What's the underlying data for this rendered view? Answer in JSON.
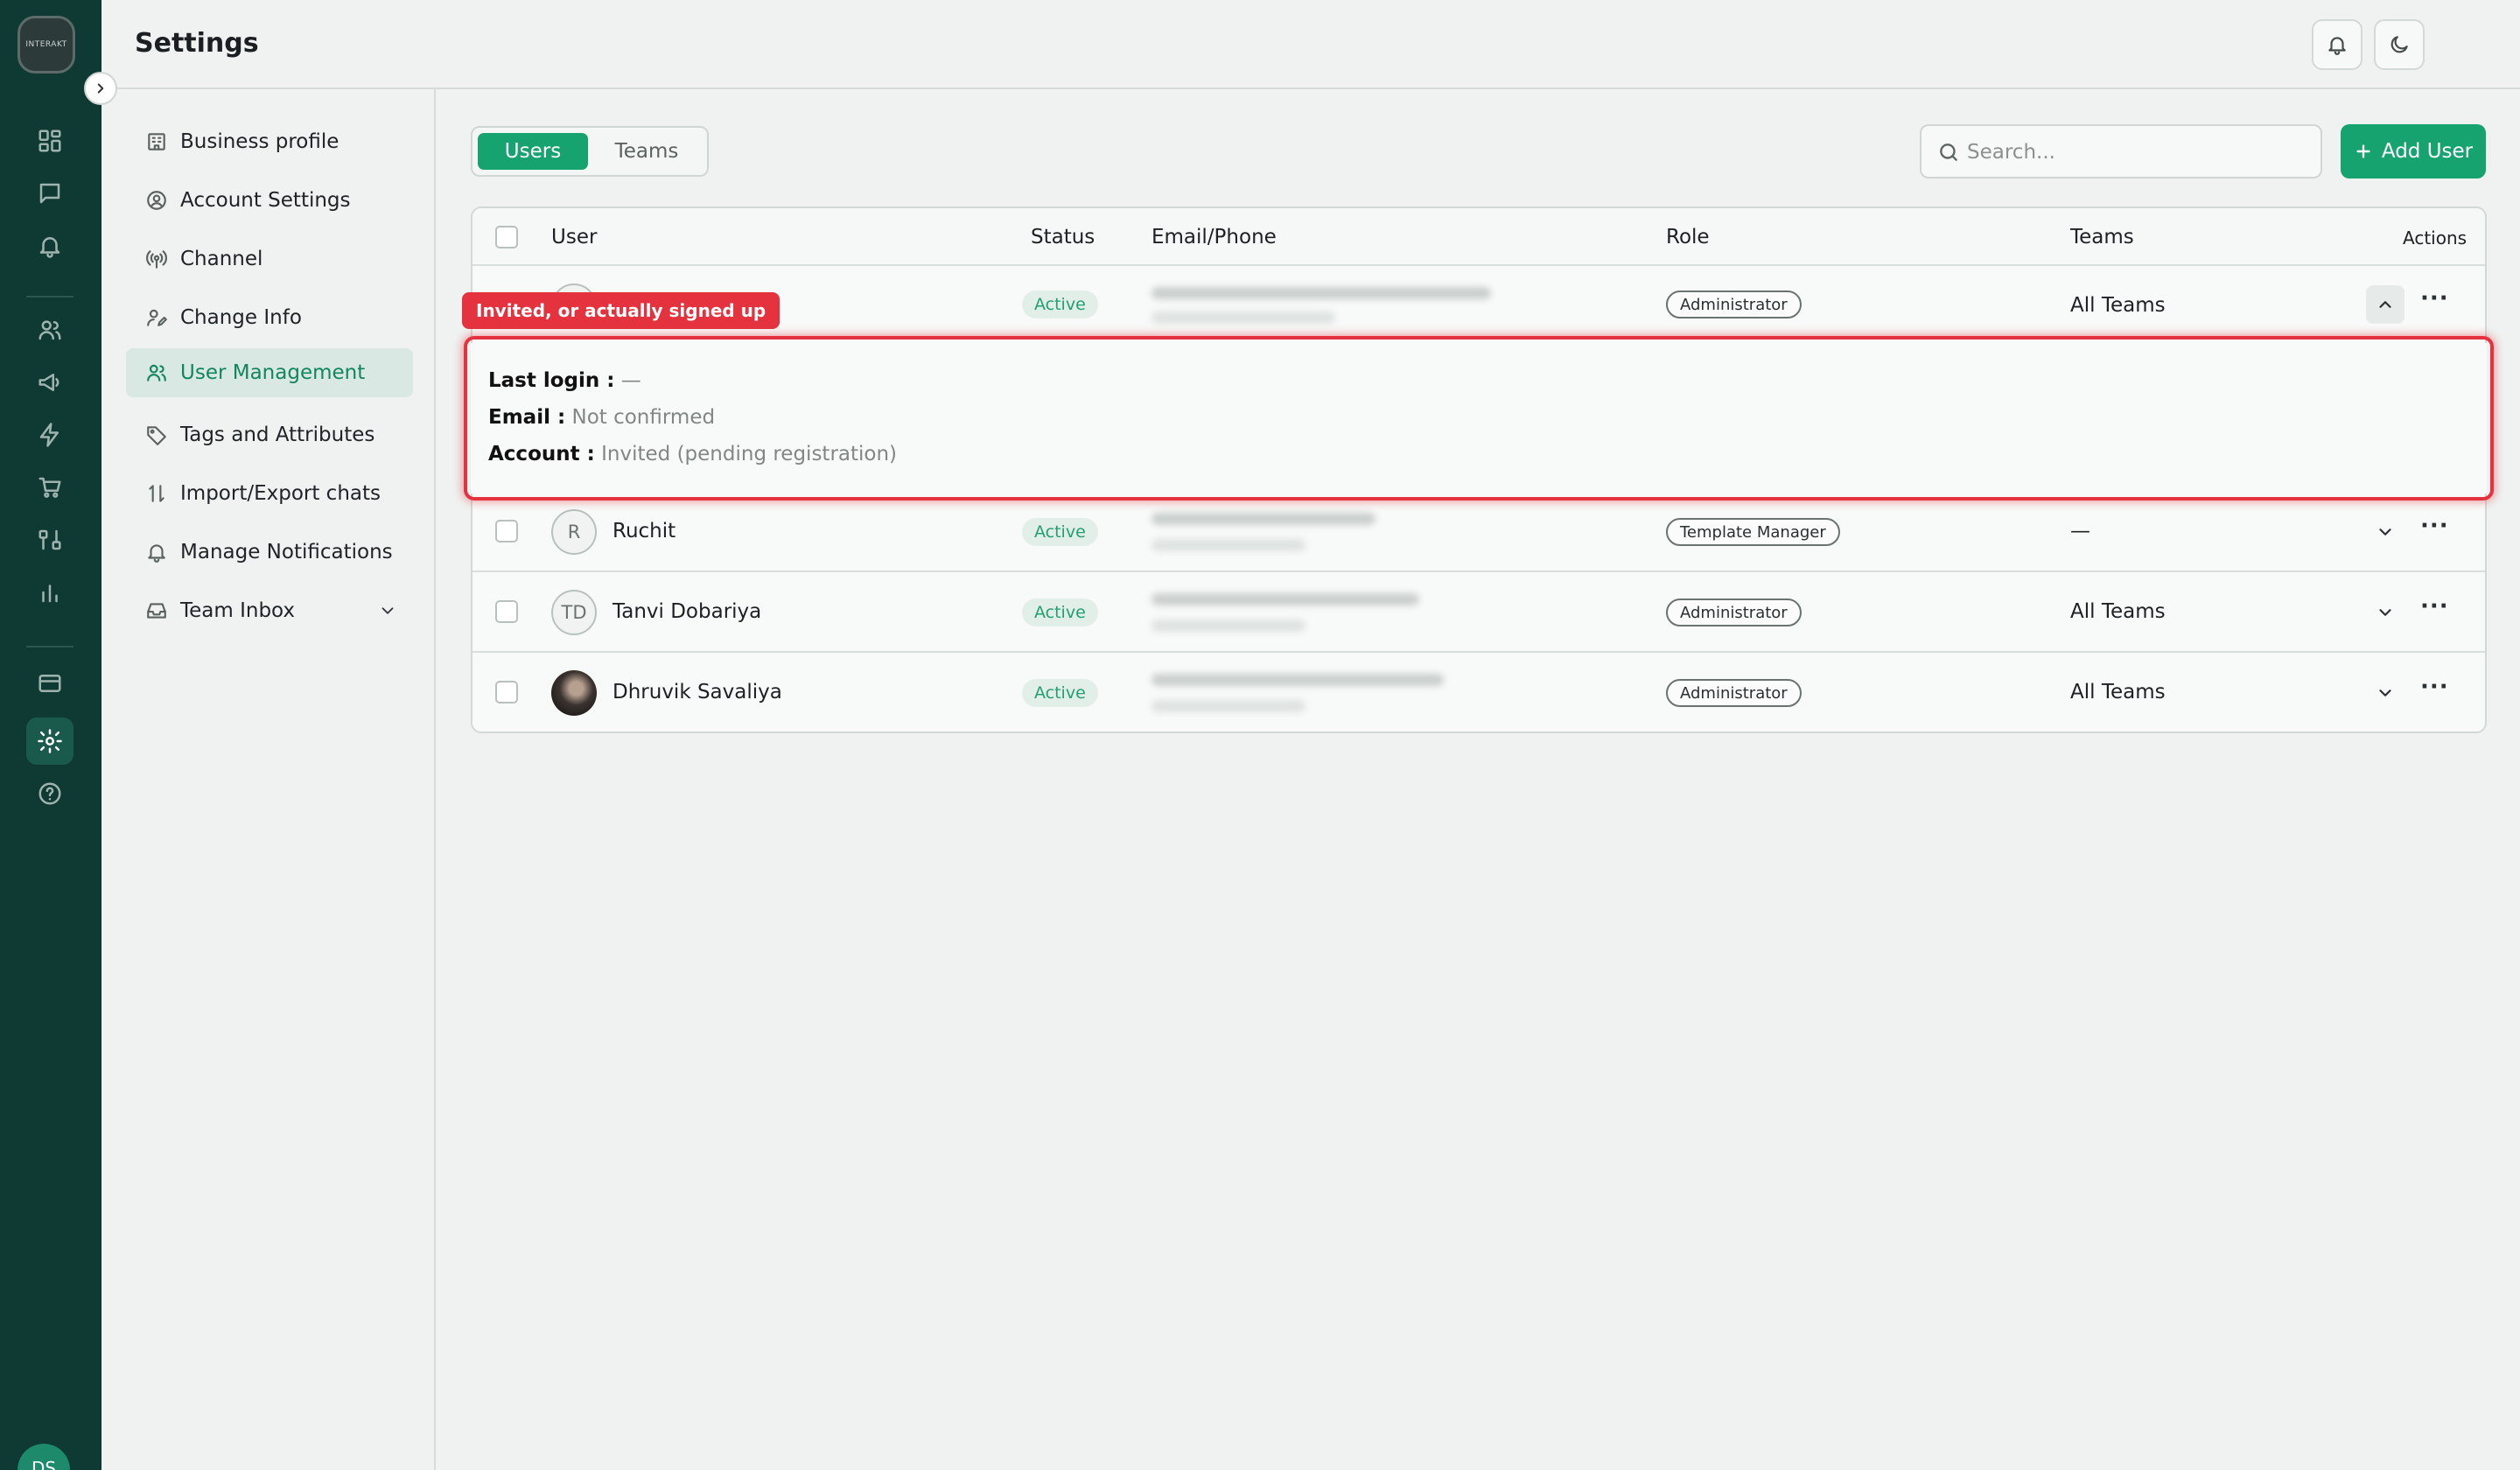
{
  "app": {
    "logo_text": "INTERAKT",
    "user_initials": "DS"
  },
  "header": {
    "title": "Settings"
  },
  "settings_nav": [
    {
      "label": "Business profile"
    },
    {
      "label": "Account Settings"
    },
    {
      "label": "Channel"
    },
    {
      "label": "Change Info"
    },
    {
      "label": "User Management",
      "active": true
    },
    {
      "label": "Tags and Attributes"
    },
    {
      "label": "Import/Export chats"
    },
    {
      "label": "Manage Notifications"
    },
    {
      "label": "Team Inbox"
    }
  ],
  "tabs": {
    "users": "Users",
    "teams": "Teams",
    "active_tab": "Users"
  },
  "search": {
    "placeholder": "Search..."
  },
  "add_user_label": "Add User",
  "table": {
    "headers": {
      "user": "User",
      "status": "Status",
      "email_phone": "Email/Phone",
      "role": "Role",
      "teams": "Teams",
      "actions": "Actions"
    },
    "rows": [
      {
        "name": "",
        "initials": "",
        "status": "Active",
        "role": "Administrator",
        "teams": "All Teams",
        "expanded": true
      },
      {
        "name": "Ruchit",
        "initials": "R",
        "status": "Active",
        "role": "Template Manager",
        "teams": "—",
        "expanded": false
      },
      {
        "name": "Tanvi Dobariya",
        "initials": "TD",
        "status": "Active",
        "role": "Administrator",
        "teams": "All Teams",
        "expanded": false
      },
      {
        "name": "Dhruvik Savaliya",
        "initials": "",
        "status": "Active",
        "role": "Administrator",
        "teams": "All Teams",
        "expanded": false
      }
    ]
  },
  "expanded_details": {
    "last_login_label": "Last login :",
    "last_login_value": "—",
    "email_label": "Email :",
    "email_value": "Not confirmed",
    "account_label": "Account :",
    "account_value": "Invited (pending registration)"
  },
  "annotation": {
    "callout": "Invited, or actually signed up",
    "color": "#e5323f"
  },
  "colors": {
    "brand": "#17a36f",
    "rail": "#0f3a33"
  }
}
